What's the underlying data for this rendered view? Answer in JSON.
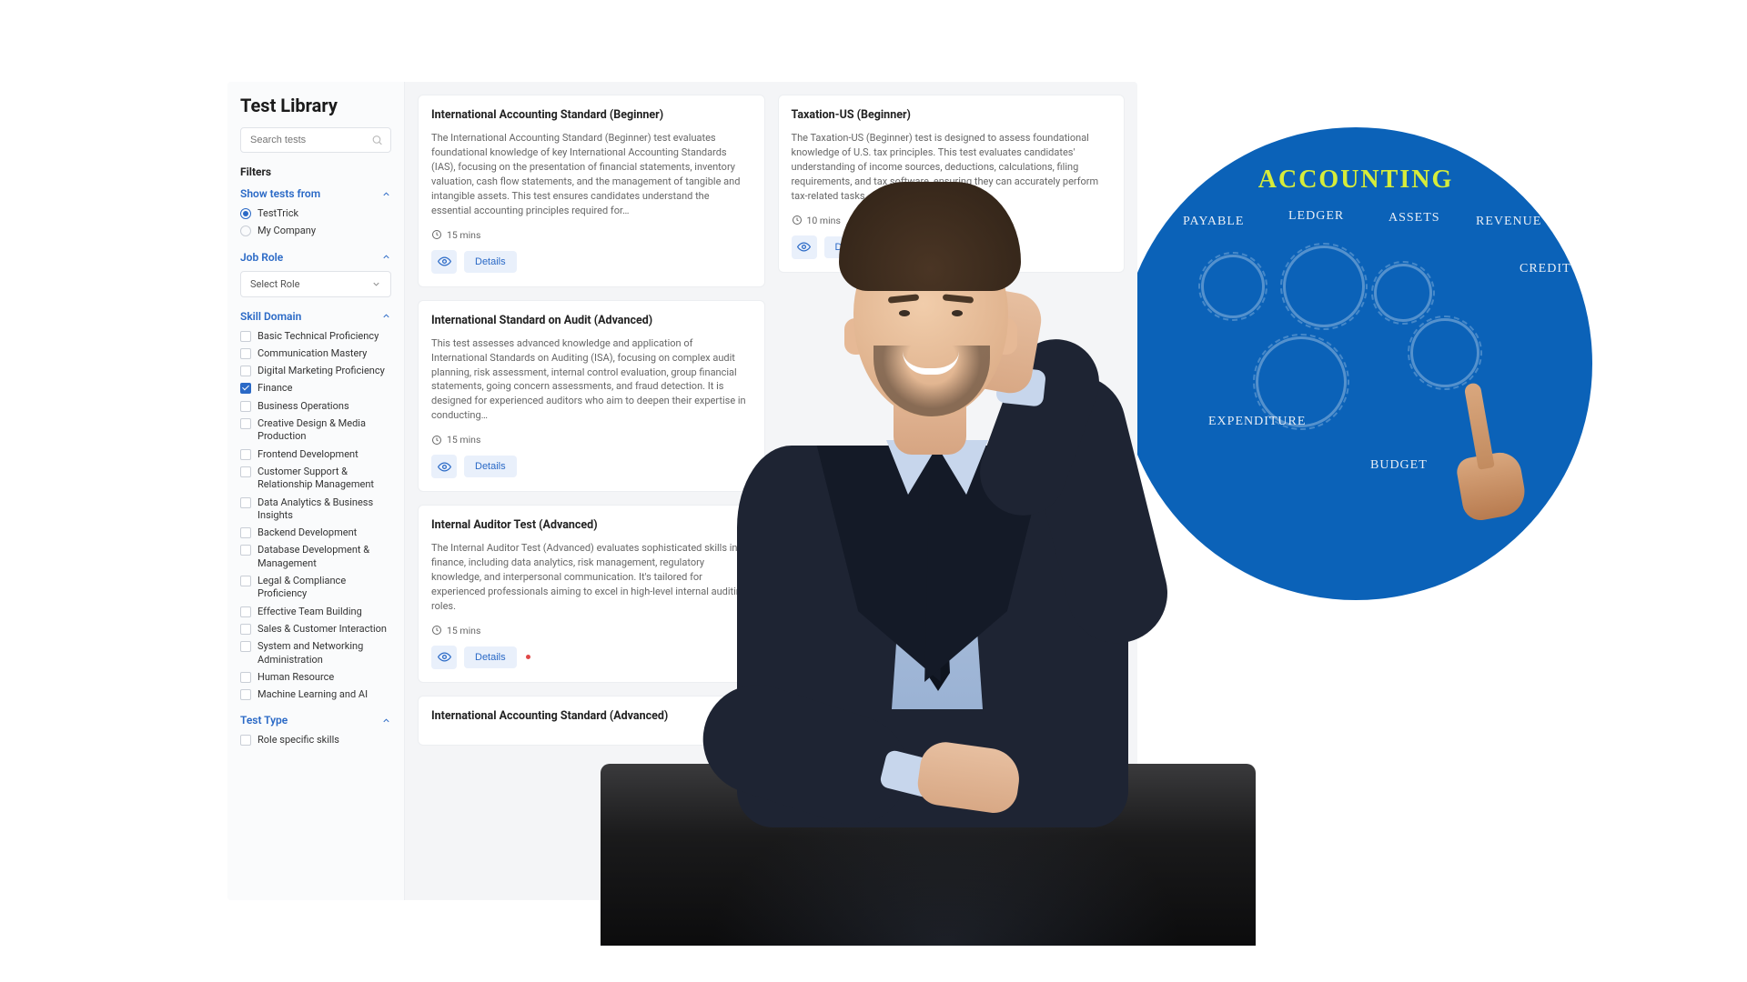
{
  "sidebar": {
    "title": "Test Library",
    "search_placeholder": "Search tests",
    "filters_label": "Filters",
    "groups": {
      "show_from": {
        "title": "Show tests from",
        "options": [
          {
            "label": "TestTrick",
            "selected": true
          },
          {
            "label": "My Company",
            "selected": false
          }
        ]
      },
      "job_role": {
        "title": "Job Role",
        "select_placeholder": "Select Role"
      },
      "skill_domain": {
        "title": "Skill Domain",
        "items": [
          {
            "label": "Basic Technical Proficiency",
            "checked": false
          },
          {
            "label": "Communication Mastery",
            "checked": false
          },
          {
            "label": "Digital Marketing Proficiency",
            "checked": false
          },
          {
            "label": "Finance",
            "checked": true
          },
          {
            "label": "Business Operations",
            "checked": false
          },
          {
            "label": "Creative Design & Media Production",
            "checked": false
          },
          {
            "label": "Frontend Development",
            "checked": false
          },
          {
            "label": "Customer Support & Relationship Management",
            "checked": false
          },
          {
            "label": "Data Analytics & Business Insights",
            "checked": false
          },
          {
            "label": "Backend Development",
            "checked": false
          },
          {
            "label": "Database Development & Management",
            "checked": false
          },
          {
            "label": "Legal & Compliance Proficiency",
            "checked": false
          },
          {
            "label": "Effective Team Building",
            "checked": false
          },
          {
            "label": "Sales & Customer Interaction",
            "checked": false
          },
          {
            "label": "System and Networking Administration",
            "checked": false
          },
          {
            "label": "Human Resource",
            "checked": false
          },
          {
            "label": "Machine Learning and AI",
            "checked": false
          }
        ]
      },
      "test_type": {
        "title": "Test Type",
        "items": [
          {
            "label": "Role specific skills",
            "checked": false
          }
        ]
      }
    }
  },
  "cards": {
    "details_label": "Details",
    "col1": [
      {
        "title": "International Accounting Standard (Beginner)",
        "desc": "The International Accounting Standard (Beginner) test evaluates foundational knowledge of key International Accounting Standards (IAS), focusing on the presentation of financial statements, inventory valuation, cash flow statements, and the management of tangible and intangible assets. This test ensures candidates understand the essential accounting principles required for…",
        "duration": "15 mins",
        "red_dot": false
      },
      {
        "title": "International Standard on Audit (Advanced)",
        "desc": "This test assesses advanced knowledge and application of International Standards on Auditing (ISA), focusing on complex audit planning, risk assessment, internal control evaluation, group financial statements, going concern assessments, and fraud detection. It is designed for experienced auditors who aim to deepen their expertise in conducting…",
        "duration": "15 mins",
        "red_dot": false
      },
      {
        "title": "Internal Auditor Test (Advanced)",
        "desc": "The Internal Auditor Test (Advanced) evaluates sophisticated skills in finance, including data analytics, risk management, regulatory knowledge, and interpersonal communication. It's tailored for experienced professionals aiming to excel in high-level internal auditing roles.",
        "duration": "15 mins",
        "red_dot": true
      },
      {
        "title": "International Accounting Standard (Advanced)",
        "desc": "",
        "duration": "",
        "red_dot": false
      }
    ],
    "col2": [
      {
        "title": "Taxation-US (Beginner)",
        "desc": "The Taxation-US (Beginner) test is designed to assess foundational knowledge of U.S. tax principles. This test evaluates candidates' understanding of income sources, deductions, calculations, filing requirements, and tax software, ensuring they can accurately perform tax-related tasks.",
        "duration": "10 mins",
        "red_dot": false
      }
    ]
  },
  "decor": {
    "title": "ACCOUNTING",
    "labels": [
      "PAYABLE",
      "LEDGER",
      "ASSETS",
      "REVENUE",
      "CREDIT",
      "EXPENDITURE",
      "BUDGET"
    ]
  }
}
